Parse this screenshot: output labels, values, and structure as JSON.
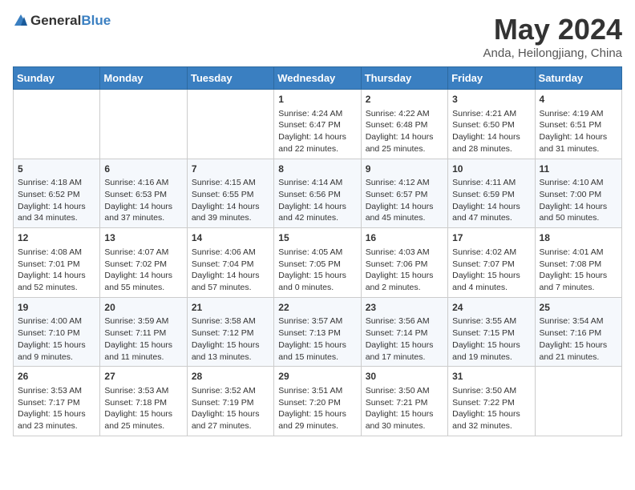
{
  "header": {
    "logo_general": "General",
    "logo_blue": "Blue",
    "month_year": "May 2024",
    "location": "Anda, Heilongjiang, China"
  },
  "weekdays": [
    "Sunday",
    "Monday",
    "Tuesday",
    "Wednesday",
    "Thursday",
    "Friday",
    "Saturday"
  ],
  "weeks": [
    [
      {
        "day": "",
        "info": ""
      },
      {
        "day": "",
        "info": ""
      },
      {
        "day": "",
        "info": ""
      },
      {
        "day": "1",
        "info": "Sunrise: 4:24 AM\nSunset: 6:47 PM\nDaylight: 14 hours\nand 22 minutes."
      },
      {
        "day": "2",
        "info": "Sunrise: 4:22 AM\nSunset: 6:48 PM\nDaylight: 14 hours\nand 25 minutes."
      },
      {
        "day": "3",
        "info": "Sunrise: 4:21 AM\nSunset: 6:50 PM\nDaylight: 14 hours\nand 28 minutes."
      },
      {
        "day": "4",
        "info": "Sunrise: 4:19 AM\nSunset: 6:51 PM\nDaylight: 14 hours\nand 31 minutes."
      }
    ],
    [
      {
        "day": "5",
        "info": "Sunrise: 4:18 AM\nSunset: 6:52 PM\nDaylight: 14 hours\nand 34 minutes."
      },
      {
        "day": "6",
        "info": "Sunrise: 4:16 AM\nSunset: 6:53 PM\nDaylight: 14 hours\nand 37 minutes."
      },
      {
        "day": "7",
        "info": "Sunrise: 4:15 AM\nSunset: 6:55 PM\nDaylight: 14 hours\nand 39 minutes."
      },
      {
        "day": "8",
        "info": "Sunrise: 4:14 AM\nSunset: 6:56 PM\nDaylight: 14 hours\nand 42 minutes."
      },
      {
        "day": "9",
        "info": "Sunrise: 4:12 AM\nSunset: 6:57 PM\nDaylight: 14 hours\nand 45 minutes."
      },
      {
        "day": "10",
        "info": "Sunrise: 4:11 AM\nSunset: 6:59 PM\nDaylight: 14 hours\nand 47 minutes."
      },
      {
        "day": "11",
        "info": "Sunrise: 4:10 AM\nSunset: 7:00 PM\nDaylight: 14 hours\nand 50 minutes."
      }
    ],
    [
      {
        "day": "12",
        "info": "Sunrise: 4:08 AM\nSunset: 7:01 PM\nDaylight: 14 hours\nand 52 minutes."
      },
      {
        "day": "13",
        "info": "Sunrise: 4:07 AM\nSunset: 7:02 PM\nDaylight: 14 hours\nand 55 minutes."
      },
      {
        "day": "14",
        "info": "Sunrise: 4:06 AM\nSunset: 7:04 PM\nDaylight: 14 hours\nand 57 minutes."
      },
      {
        "day": "15",
        "info": "Sunrise: 4:05 AM\nSunset: 7:05 PM\nDaylight: 15 hours\nand 0 minutes."
      },
      {
        "day": "16",
        "info": "Sunrise: 4:03 AM\nSunset: 7:06 PM\nDaylight: 15 hours\nand 2 minutes."
      },
      {
        "day": "17",
        "info": "Sunrise: 4:02 AM\nSunset: 7:07 PM\nDaylight: 15 hours\nand 4 minutes."
      },
      {
        "day": "18",
        "info": "Sunrise: 4:01 AM\nSunset: 7:08 PM\nDaylight: 15 hours\nand 7 minutes."
      }
    ],
    [
      {
        "day": "19",
        "info": "Sunrise: 4:00 AM\nSunset: 7:10 PM\nDaylight: 15 hours\nand 9 minutes."
      },
      {
        "day": "20",
        "info": "Sunrise: 3:59 AM\nSunset: 7:11 PM\nDaylight: 15 hours\nand 11 minutes."
      },
      {
        "day": "21",
        "info": "Sunrise: 3:58 AM\nSunset: 7:12 PM\nDaylight: 15 hours\nand 13 minutes."
      },
      {
        "day": "22",
        "info": "Sunrise: 3:57 AM\nSunset: 7:13 PM\nDaylight: 15 hours\nand 15 minutes."
      },
      {
        "day": "23",
        "info": "Sunrise: 3:56 AM\nSunset: 7:14 PM\nDaylight: 15 hours\nand 17 minutes."
      },
      {
        "day": "24",
        "info": "Sunrise: 3:55 AM\nSunset: 7:15 PM\nDaylight: 15 hours\nand 19 minutes."
      },
      {
        "day": "25",
        "info": "Sunrise: 3:54 AM\nSunset: 7:16 PM\nDaylight: 15 hours\nand 21 minutes."
      }
    ],
    [
      {
        "day": "26",
        "info": "Sunrise: 3:53 AM\nSunset: 7:17 PM\nDaylight: 15 hours\nand 23 minutes."
      },
      {
        "day": "27",
        "info": "Sunrise: 3:53 AM\nSunset: 7:18 PM\nDaylight: 15 hours\nand 25 minutes."
      },
      {
        "day": "28",
        "info": "Sunrise: 3:52 AM\nSunset: 7:19 PM\nDaylight: 15 hours\nand 27 minutes."
      },
      {
        "day": "29",
        "info": "Sunrise: 3:51 AM\nSunset: 7:20 PM\nDaylight: 15 hours\nand 29 minutes."
      },
      {
        "day": "30",
        "info": "Sunrise: 3:50 AM\nSunset: 7:21 PM\nDaylight: 15 hours\nand 30 minutes."
      },
      {
        "day": "31",
        "info": "Sunrise: 3:50 AM\nSunset: 7:22 PM\nDaylight: 15 hours\nand 32 minutes."
      },
      {
        "day": "",
        "info": ""
      }
    ]
  ]
}
